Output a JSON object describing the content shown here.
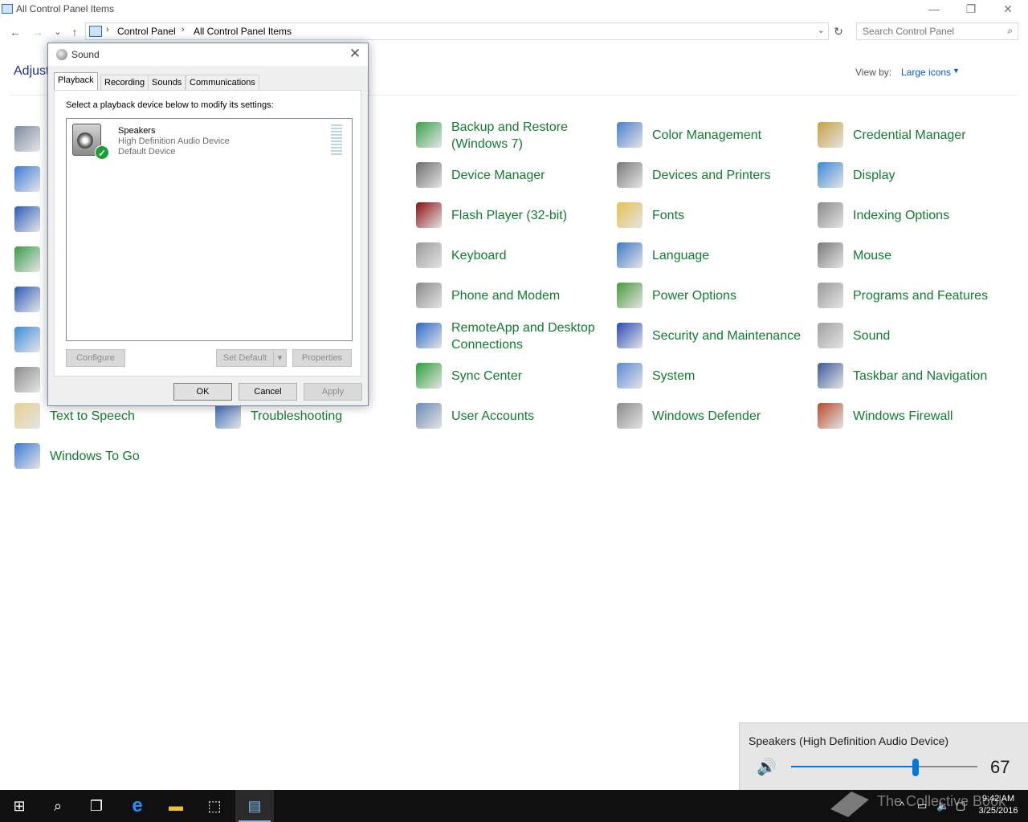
{
  "window": {
    "title": "All Control Panel Items",
    "controls": {
      "minimize": "—",
      "restore": "❐",
      "close": "✕"
    }
  },
  "nav": {
    "back": "←",
    "forward": "→",
    "recent": "⌄",
    "up": "↑"
  },
  "address": {
    "crumbs": [
      "Control Panel",
      "All Control Panel Items"
    ],
    "separator": "›",
    "dropdown": "⌄",
    "refresh": "↻"
  },
  "search": {
    "placeholder": "Search Control Panel",
    "icon": "⌕"
  },
  "header": {
    "heading_partial": "Adjust",
    "view_by_label": "View by:",
    "view_by_value": "Large icons",
    "caret": "▼"
  },
  "items": [
    {
      "label": "Backup and Restore\n(Windows 7)",
      "icon": "backup-restore-icon",
      "color": "#3aa34a"
    },
    {
      "label": "Color Management",
      "icon": "color-management-icon",
      "color": "#4a7fd0"
    },
    {
      "label": "Credential Manager",
      "icon": "credential-manager-icon",
      "color": "#c8a040"
    },
    {
      "label": "Device Manager",
      "icon": "device-manager-icon",
      "color": "#6d6d6d"
    },
    {
      "label": "Devices and Printers",
      "icon": "devices-printers-icon",
      "color": "#7a7a7a"
    },
    {
      "label": "Display",
      "icon": "display-icon",
      "color": "#3a8ad8"
    },
    {
      "label": "Flash Player (32-bit)",
      "icon": "flash-player-icon",
      "color": "#8b1010"
    },
    {
      "label": "Fonts",
      "icon": "fonts-icon",
      "color": "#e8c050"
    },
    {
      "label": "Indexing Options",
      "icon": "indexing-options-icon",
      "color": "#8a8a8a"
    },
    {
      "label": "Keyboard",
      "icon": "keyboard-icon",
      "color": "#9a9a9a"
    },
    {
      "label": "Language",
      "icon": "language-icon",
      "color": "#3a7ac8"
    },
    {
      "label": "Mouse",
      "icon": "mouse-icon",
      "color": "#7a7a7a"
    },
    {
      "label": "Phone and Modem",
      "icon": "phone-modem-icon",
      "color": "#8a8a8a"
    },
    {
      "label": "Power Options",
      "icon": "power-options-icon",
      "color": "#4a9a3a"
    },
    {
      "label": "Programs and Features",
      "icon": "programs-features-icon",
      "color": "#9a9a9a"
    },
    {
      "label": "RemoteApp and Desktop\nConnections",
      "icon": "remoteapp-icon",
      "color": "#2a6ac8"
    },
    {
      "label": "Security and Maintenance",
      "icon": "security-maintenance-icon",
      "color": "#2a4ab8"
    },
    {
      "label": "Sound",
      "icon": "sound-icon",
      "color": "#a0a0a0"
    },
    {
      "label": "Sync Center",
      "icon": "sync-center-icon",
      "color": "#2aa03a"
    },
    {
      "label": "System",
      "icon": "system-icon",
      "color": "#5a8ad8"
    },
    {
      "label": "Taskbar and Navigation",
      "icon": "taskbar-navigation-icon",
      "color": "#3a5a9a"
    },
    {
      "label": "Text to Speech",
      "icon": "text-to-speech-icon",
      "color": "#e8d090"
    },
    {
      "label": "Troubleshooting",
      "icon": "troubleshooting-icon",
      "color": "#3a6ab8"
    },
    {
      "label": "User Accounts",
      "icon": "user-accounts-icon",
      "color": "#6a8ab8"
    },
    {
      "label": "Windows Defender",
      "icon": "windows-defender-icon",
      "color": "#8a8a8a"
    },
    {
      "label": "Windows Firewall",
      "icon": "windows-firewall-icon",
      "color": "#b84a2a"
    },
    {
      "label": "Windows To Go",
      "icon": "windows-to-go-icon",
      "color": "#3a7ad8"
    }
  ],
  "left_icons": [
    {
      "icon": "administrative-tools-icon",
      "color": "#7a8aa0"
    },
    {
      "icon": "date-time-icon",
      "color": "#3a7ad8"
    },
    {
      "icon": "ease-of-access-icon",
      "color": "#2a5ab8"
    },
    {
      "icon": "internet-options-icon",
      "color": "#3a9a4a"
    },
    {
      "icon": "network-sharing-icon",
      "color": "#2a5ab8"
    },
    {
      "icon": "recovery-icon",
      "color": "#3a8ad8"
    },
    {
      "icon": "speech-recognition-icon",
      "color": "#8a8a8a"
    }
  ],
  "sound_dialog": {
    "title": "Sound",
    "close": "✕",
    "tabs": [
      "Playback",
      "Recording",
      "Sounds",
      "Communications"
    ],
    "instruction": "Select a playback device below to modify its settings:",
    "device": {
      "name": "Speakers",
      "description": "High Definition Audio Device",
      "status": "Default Device",
      "check": "✓"
    },
    "buttons": {
      "configure": "Configure",
      "set_default": "Set Default",
      "set_default_arrow": "▾",
      "properties": "Properties",
      "ok": "OK",
      "cancel": "Cancel",
      "apply": "Apply"
    }
  },
  "volume_flyout": {
    "device": "Speakers (High Definition Audio Device)",
    "speaker_icon": "🔊",
    "value": 67,
    "value_text": "67"
  },
  "taskbar": {
    "start": "⊞",
    "search": "⌕",
    "task_view": "❐",
    "edge": "e",
    "explorer": "▬",
    "store": "⬚",
    "control_panel": "▤",
    "tray_up": "^",
    "tray_network": "▭",
    "tray_volume": "🔈",
    "tray_action": "▢",
    "time": "9:42 AM",
    "date": "3/25/2016"
  },
  "watermark": "The Collective Book",
  "colors": {
    "link_green": "#127b2f",
    "accent_blue": "#0078d7",
    "taskbar": "#101010"
  }
}
